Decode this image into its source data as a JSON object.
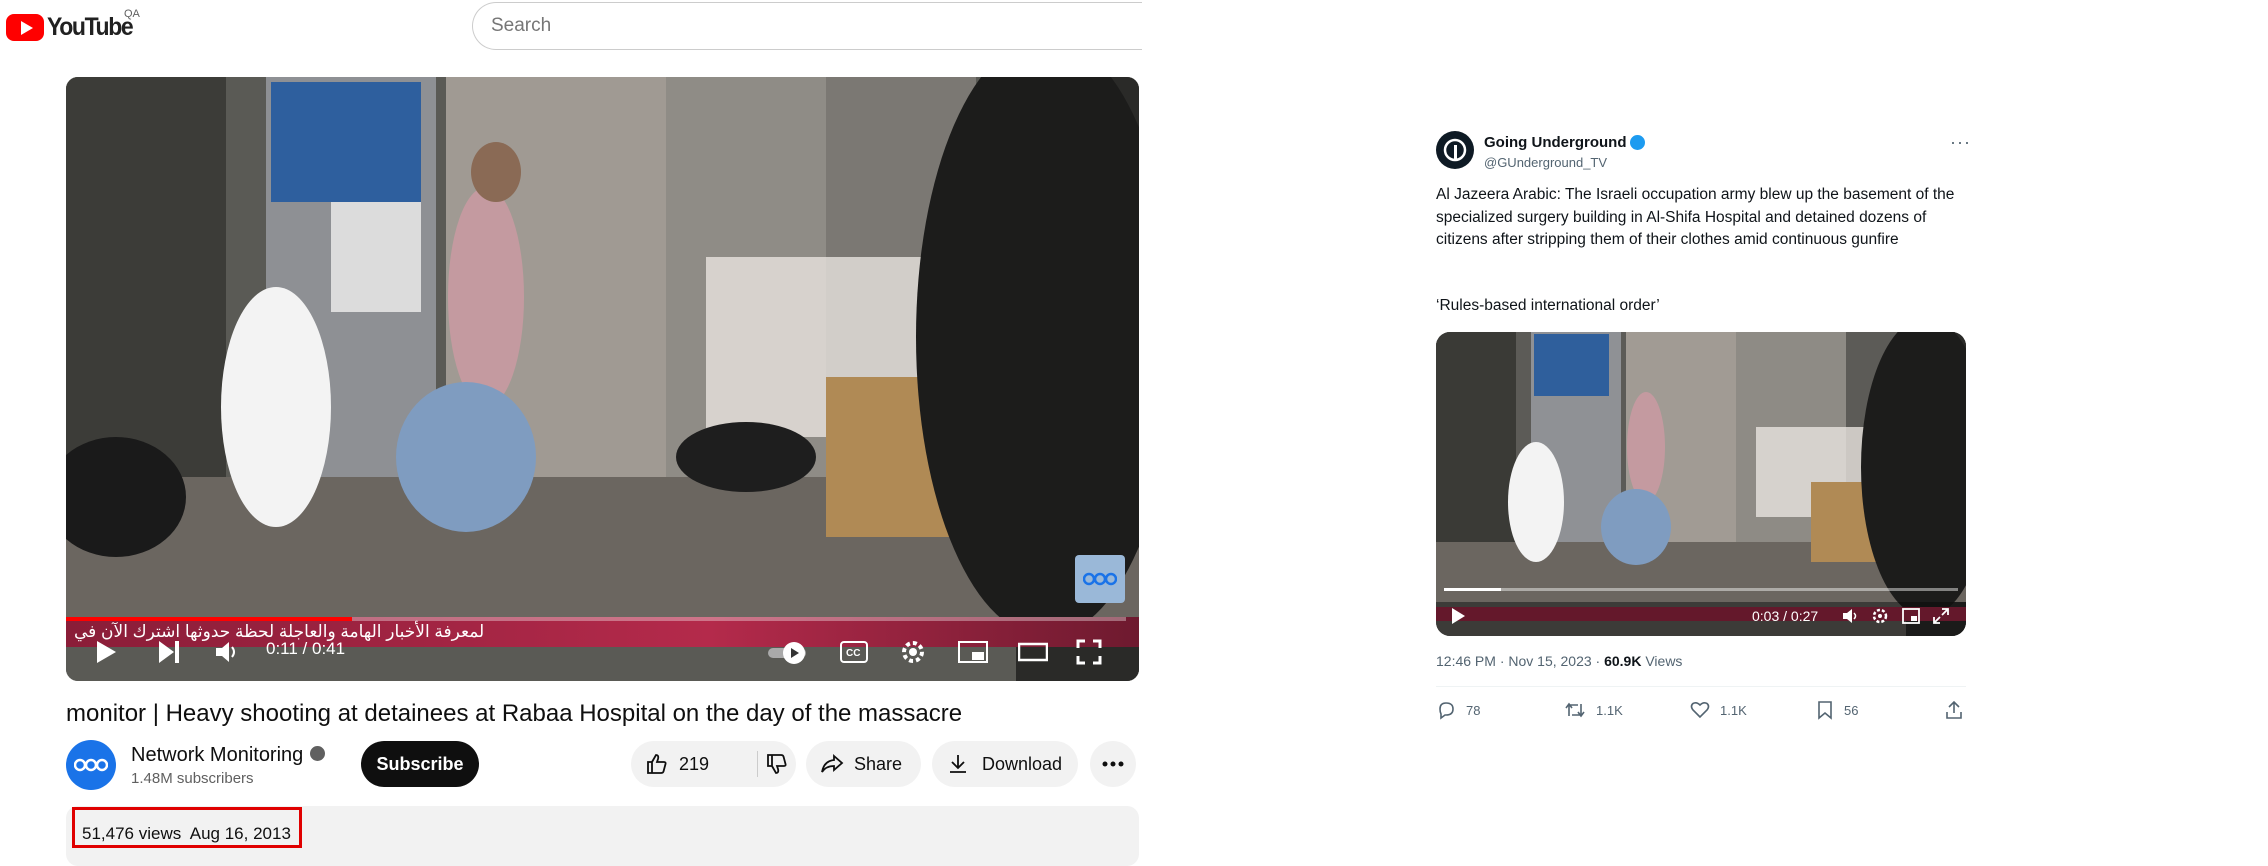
{
  "youtube": {
    "logo_text": "YouTube",
    "country_code": "QA",
    "search_placeholder": "Search",
    "player": {
      "ticker_text": "لمعرفة الأخبار الهامة والعاجلة لحظة حدوثها اشترك الآن في",
      "time": "0:11 / 0:41",
      "progress_fraction": 0.27
    },
    "video_title": "monitor | Heavy shooting at detainees at Rabaa Hospital on the day of the massacre",
    "channel": {
      "name": "Network Monitoring",
      "subscribers": "1.48M subscribers"
    },
    "subscribe_label": "Subscribe",
    "like_count": "219",
    "share_label": "Share",
    "download_label": "Download",
    "description": {
      "views": "51,476 views",
      "date": "Aug 16, 2013"
    },
    "highlight_color": "#e00000"
  },
  "tweet": {
    "name": "Going Underground",
    "handle": "@GUnderground_TV",
    "text": "Al Jazeera Arabic: The Israeli occupation army blew up the basement of the specialized surgery building in Al-Shifa Hospital and detained dozens of citizens after stripping them of their clothes amid continuous gunfire",
    "text2": "‘Rules-based international order’",
    "video_time": "0:03 / 0:27",
    "video_progress_fraction": 0.11,
    "timestamp": "12:46 PM · Nov 15, 2023 · ",
    "views_count": "60.9K",
    "views_label": " Views",
    "replies": "78",
    "reposts": "1.1K",
    "likes": "1.1K",
    "bookmarks": "56"
  }
}
